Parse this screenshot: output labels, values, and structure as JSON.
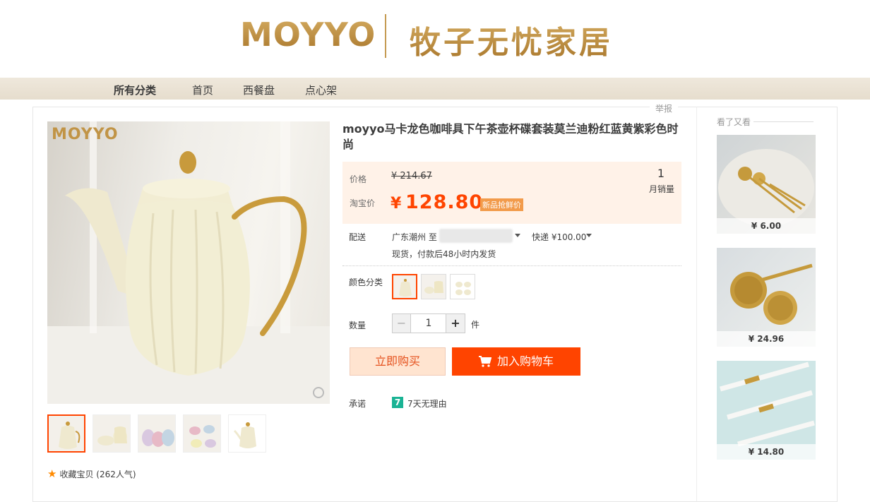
{
  "header": {
    "brand_en": "MOYYO",
    "brand_cn": "牧子无忧家居"
  },
  "nav": {
    "items": [
      "所有分类",
      "首页",
      "西餐盘",
      "点心架"
    ]
  },
  "report_label": "举报",
  "gallery": {
    "main_logo": "MOYYO",
    "favorite": "收藏宝贝 (262人气)"
  },
  "product": {
    "title": "moyyo马卡龙色咖啡具下午茶壶杯碟套装莫兰迪粉红蓝黄紫彩色时尚",
    "price_label": "价格",
    "original_price": "¥ 214.67",
    "taobao_label": "淘宝价",
    "currency": "¥",
    "price": "128.80",
    "price_tag": "新品抢鲜价",
    "monthly_sales": "1",
    "monthly_sales_label": "月销量",
    "shipping_label": "配送",
    "ship_from": "广东潮州 至",
    "shipping_fee": "快递 ¥100.00",
    "ship_note": "现货，付款后48小时内发货",
    "color_label": "颜色分类",
    "qty_label": "数量",
    "qty_minus": "−",
    "qty_value": "1",
    "qty_plus": "+",
    "qty_unit": "件",
    "buy_now": "立即购买",
    "add_to_cart": "加入购物车",
    "promise_label": "承诺",
    "promise_icon": "7",
    "promise_text": "7天无理由"
  },
  "sidebar": {
    "title": "看了又看",
    "items": [
      {
        "price": "¥ 6.00"
      },
      {
        "price": "¥ 24.96"
      },
      {
        "price": "¥ 14.80"
      }
    ]
  },
  "colors": {
    "accent": "#ff4400",
    "gold": "#b8893f",
    "price_panel_bg": "#fff2e8"
  }
}
